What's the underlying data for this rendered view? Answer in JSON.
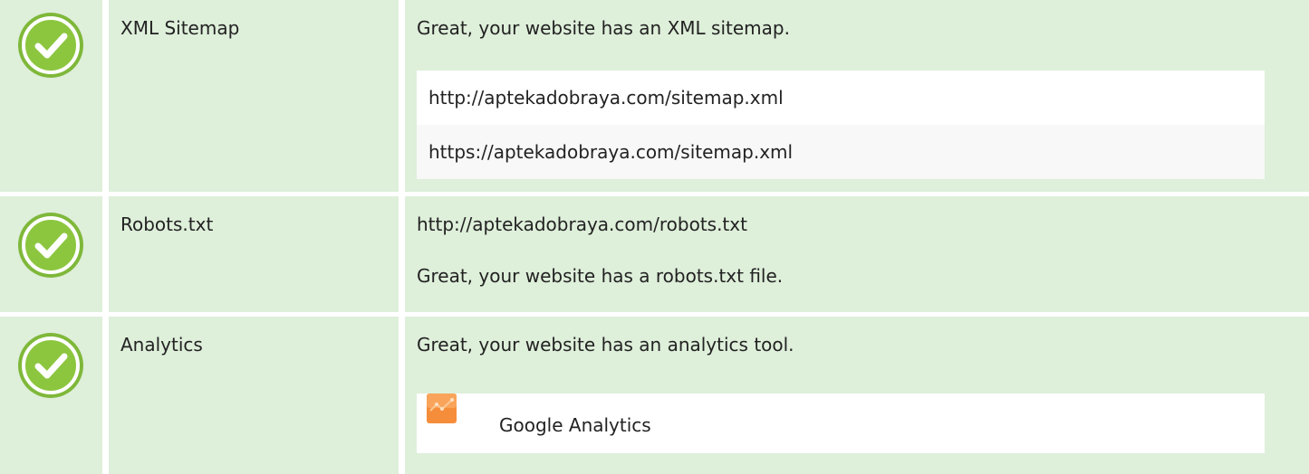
{
  "rows": [
    {
      "name": "XML Sitemap",
      "status": "pass",
      "message": "Great, your website has an XML sitemap.",
      "sitemaps": [
        "http://aptekadobraya.com/sitemap.xml",
        "https://aptekadobraya.com/sitemap.xml"
      ]
    },
    {
      "name": "Robots.txt",
      "status": "pass",
      "url": "http://aptekadobraya.com/robots.txt",
      "message": "Great, your website has a robots.txt file."
    },
    {
      "name": "Analytics",
      "status": "pass",
      "message": "Great, your website has an analytics tool.",
      "tools": [
        {
          "label": "Google Analytics",
          "icon": "google-analytics-icon"
        }
      ]
    }
  ],
  "colors": {
    "row_bg": "#deefda",
    "check_fill": "#8cc63f",
    "check_ring": "#ffffff",
    "ga_orange": "#f68d3b"
  },
  "icons": {
    "status": "check-circle-icon"
  }
}
